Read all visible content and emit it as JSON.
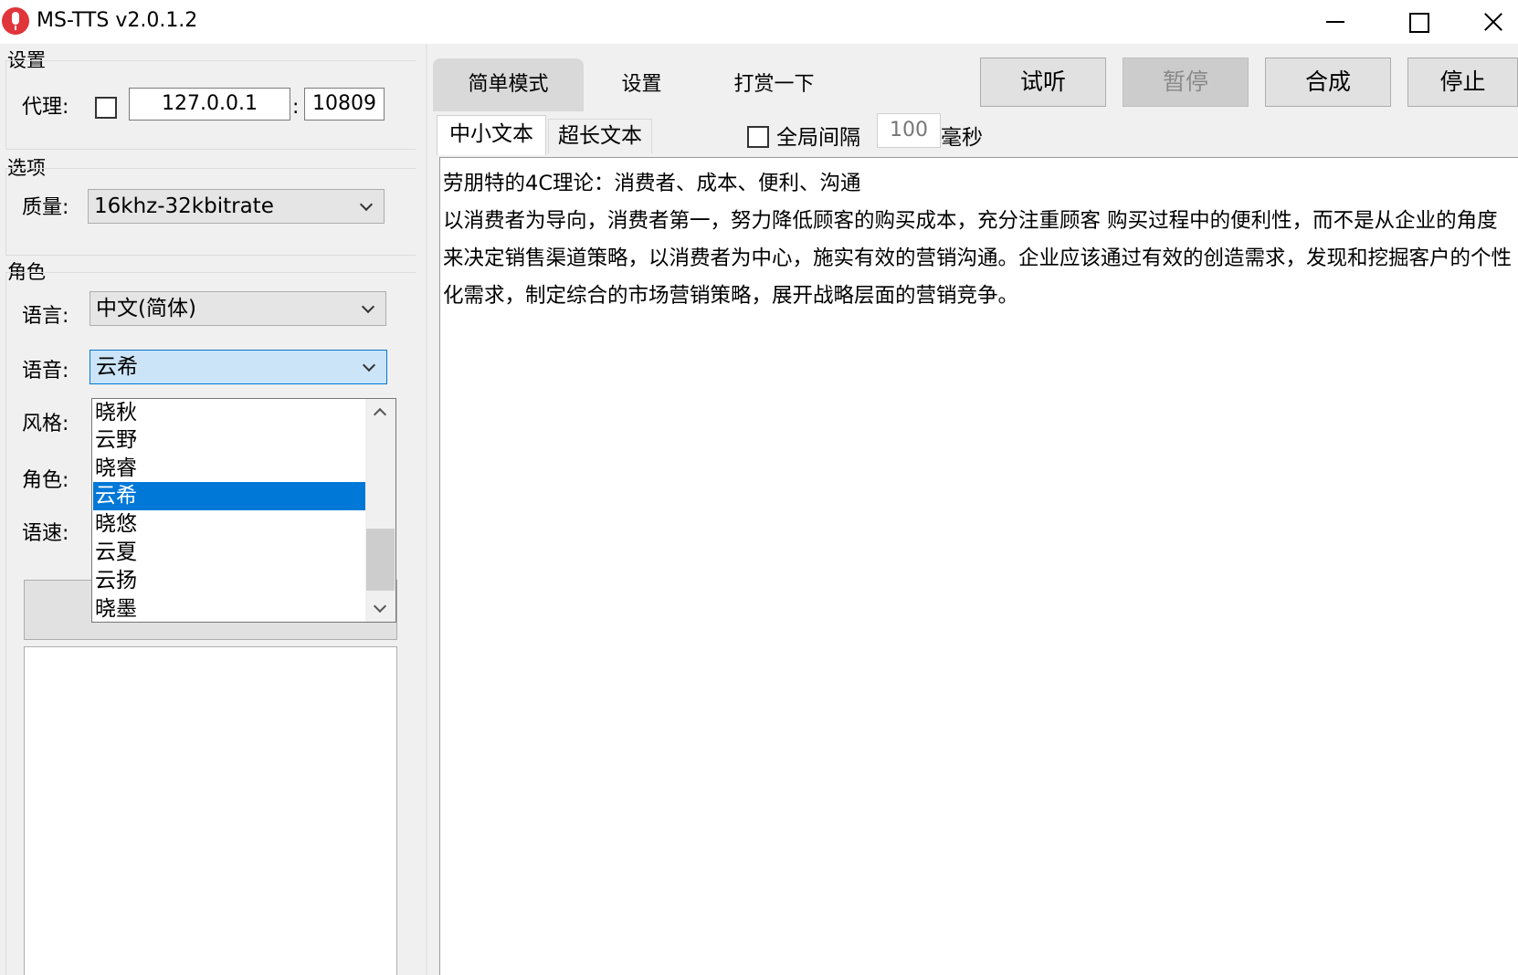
{
  "window": {
    "title": "MS-TTS v2.0.1.2"
  },
  "settings_group": {
    "title": "设置",
    "proxy_label": "代理:",
    "proxy_enabled": false,
    "proxy_host": "127.0.0.1",
    "colon": ":",
    "proxy_port": "10809"
  },
  "options_group": {
    "title": "选项",
    "quality_label": "质量:",
    "quality_value": "16khz-32kbitrate"
  },
  "role_group": {
    "title": "角色",
    "language_label": "语言:",
    "language_value": "中文(简体)",
    "voice_label": "语音:",
    "voice_value": "云希",
    "style_label": "风格:",
    "role_label": "角色:",
    "speed_label": "语速:",
    "voice_options": [
      "晓秋",
      "云野",
      "晓睿",
      "云希",
      "晓悠",
      "云夏",
      "云扬",
      "晓墨"
    ],
    "voice_selected": "云希"
  },
  "mode_tabs": [
    "简单模式",
    "设置",
    "打赏一下"
  ],
  "actions": {
    "preview": "试听",
    "pause": "暂停",
    "synthesize": "合成",
    "stop": "停止"
  },
  "text_tabs": {
    "short": "中小文本",
    "long": "超长文本",
    "global_interval_label": "全局间隔",
    "global_interval_enabled": false,
    "interval_value": "100",
    "interval_unit": "毫秒"
  },
  "text_content": "劳朋特的4C理论：消费者、成本、便利、沟通\n以消费者为导向，消费者第一，努力降低顾客的购买成本，充分注重顾客 购买过程中的便利性，而不是从企业的角度来决定销售渠道策略，以消费者为中心，施实有效的营销沟通。企业应该通过有效的创造需求，发现和挖掘客户的个性化需求，制定综合的市场营销策略，展开战略层面的营销竞争。",
  "colors": {
    "accent": "#0078d7",
    "focus_bg": "#cce4f7",
    "app_icon": "#e0353b"
  },
  "icons": {
    "app": "microphone-icon",
    "minimize": "minimize-icon",
    "maximize": "maximize-icon",
    "close": "close-icon"
  }
}
